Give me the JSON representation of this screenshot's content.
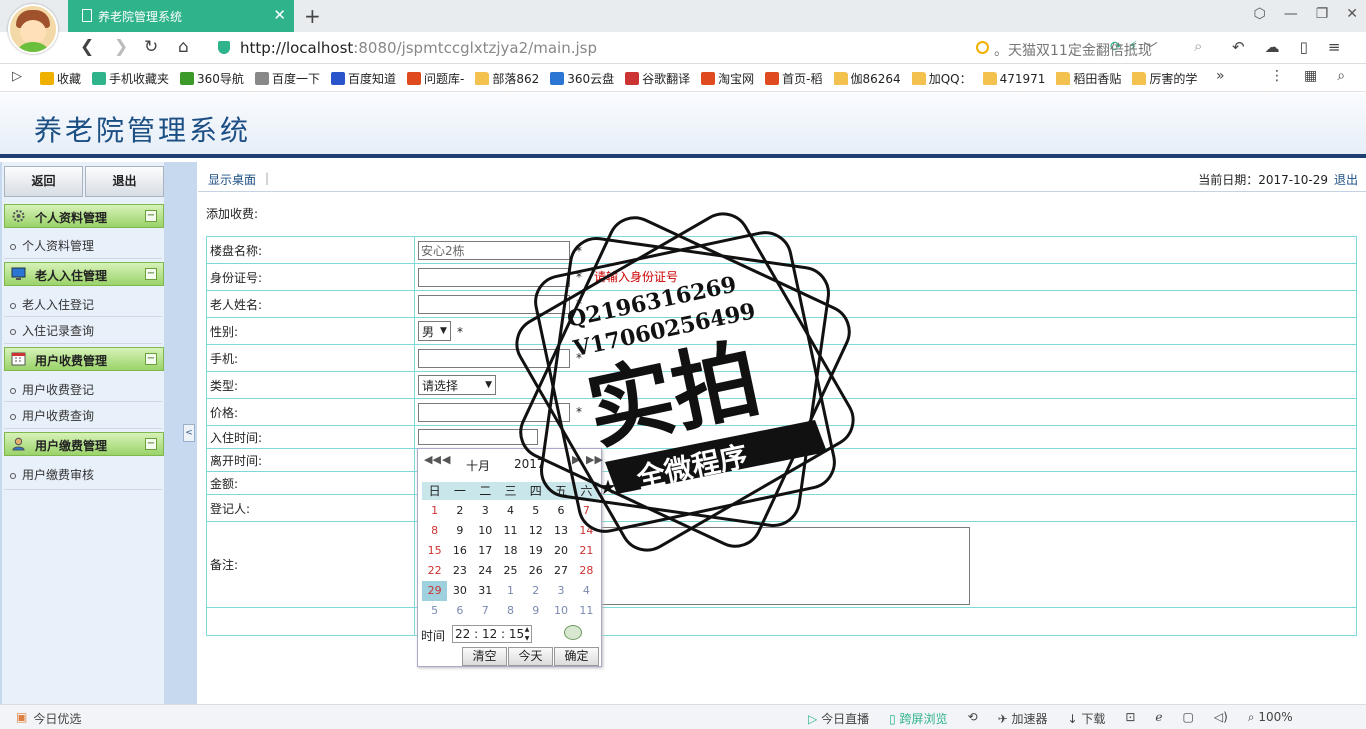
{
  "browser": {
    "tab_title": "养老院管理系统",
    "tab_close": "✕",
    "new_tab": "+",
    "url_host": "http://localhost",
    "url_rest": ":8080/jspmtccglxtzjya2/main.jsp",
    "search_placeholder": "天猫双11定金翻倍抵现",
    "search_prefix": "。",
    "bookmarks": [
      {
        "label": "收藏",
        "icon": "star-icon",
        "color": "#f0b000"
      },
      {
        "label": "手机收藏夹",
        "icon": "phone-icon",
        "color": "#2fb38b"
      },
      {
        "label": "360导航",
        "icon": "360-icon",
        "color": "#3c9a2a"
      },
      {
        "label": "百度一下",
        "icon": "bear-paw-icon",
        "color": "#888"
      },
      {
        "label": "百度知道",
        "icon": "baidu-icon",
        "color": "#2a54c9"
      },
      {
        "label": "问题库-",
        "icon": "s-icon",
        "color": "#e04a1f"
      },
      {
        "label": "部落862",
        "icon": "folder-icon",
        "color": "#f2c14e"
      },
      {
        "label": "360云盘",
        "icon": "cloud-icon",
        "color": "#2a76d2"
      },
      {
        "label": "谷歌翻译",
        "icon": "translate-icon",
        "color": "#c33"
      },
      {
        "label": "淘宝网",
        "icon": "taobao-icon",
        "color": "#e04a1f"
      },
      {
        "label": "首页-稻",
        "icon": "taobao-icon",
        "color": "#e04a1f"
      },
      {
        "label": "伽86264",
        "icon": "folder-icon",
        "color": "#f2c14e"
      },
      {
        "label": "加QQ：",
        "icon": "folder-icon",
        "color": "#f2c14e"
      },
      {
        "label": "471971",
        "icon": "folder-icon",
        "color": "#f2c14e"
      },
      {
        "label": "稻田香贴",
        "icon": "folder-icon",
        "color": "#f2c14e"
      },
      {
        "label": "厉害的学",
        "icon": "folder-icon",
        "color": "#f2c14e"
      }
    ],
    "bm_more": "»"
  },
  "app": {
    "title": "养老院管理系统"
  },
  "sidebar": {
    "back": "返回",
    "exit": "退出",
    "groups": [
      {
        "title": "个人资料管理",
        "icon": "gear-icon",
        "items": [
          "个人资料管理"
        ]
      },
      {
        "title": "老人入住管理",
        "icon": "monitor-icon",
        "items": [
          "老人入住登记",
          "入住记录查询"
        ]
      },
      {
        "title": "用户收费管理",
        "icon": "calendar-icon",
        "items": [
          "用户收费登记",
          "用户收费查询"
        ]
      },
      {
        "title": "用户缴费管理",
        "icon": "user-icon",
        "items": [
          "用户缴费审核"
        ]
      }
    ],
    "toggle": "−",
    "collapse": "<"
  },
  "topbar": {
    "show_desktop": "显示桌面",
    "sep": "|",
    "date_text": "当前日期：2017-10-29",
    "logout": "退出"
  },
  "form": {
    "heading": "添加收费:",
    "labels": {
      "building": "楼盘名称:",
      "id_card": "身份证号:",
      "name": "老人姓名:",
      "gender": "性别:",
      "phone": "手机:",
      "type": "类型:",
      "price": "价格:",
      "checkin": "入住时间:",
      "checkout": "离开时间:",
      "amount": "金额:",
      "registrar": "登记人:",
      "remark": "备注:"
    },
    "building_value": "安心2栋",
    "required": "*",
    "id_hint": "请输入身份证号",
    "gender_value": "男",
    "type_value": "请选择"
  },
  "datepicker": {
    "nav_prev_year": "◀◀",
    "nav_prev_month": "◀",
    "nav_next_month": "▶",
    "nav_next_year": "▶▶",
    "month": "十月",
    "year": "2017",
    "weekdays": [
      "日",
      "一",
      "二",
      "三",
      "四",
      "五",
      "六"
    ],
    "weeks": [
      [
        "1",
        "2",
        "3",
        "4",
        "5",
        "6",
        "7"
      ],
      [
        "8",
        "9",
        "10",
        "11",
        "12",
        "13",
        "14"
      ],
      [
        "15",
        "16",
        "17",
        "18",
        "19",
        "20",
        "21"
      ],
      [
        "22",
        "23",
        "24",
        "25",
        "26",
        "27",
        "28"
      ],
      [
        "29",
        "30",
        "31",
        "1",
        "2",
        "3",
        "4"
      ],
      [
        "5",
        "6",
        "7",
        "8",
        "9",
        "10",
        "11"
      ]
    ],
    "selected_day": "29",
    "time_label": "时间",
    "time_value": "22 : 12 : 15",
    "clear": "清空",
    "today": "今天",
    "ok": "确定"
  },
  "stamp": {
    "line1": "Q2196316269",
    "line2": "V17060256499",
    "big": "实拍",
    "banner": "全微程序"
  },
  "statusbar": {
    "left": "今日优选",
    "live": "今日直播",
    "cross": "跨屏浏览",
    "speed": "加速器",
    "download": "下载",
    "zoom": "100%"
  }
}
